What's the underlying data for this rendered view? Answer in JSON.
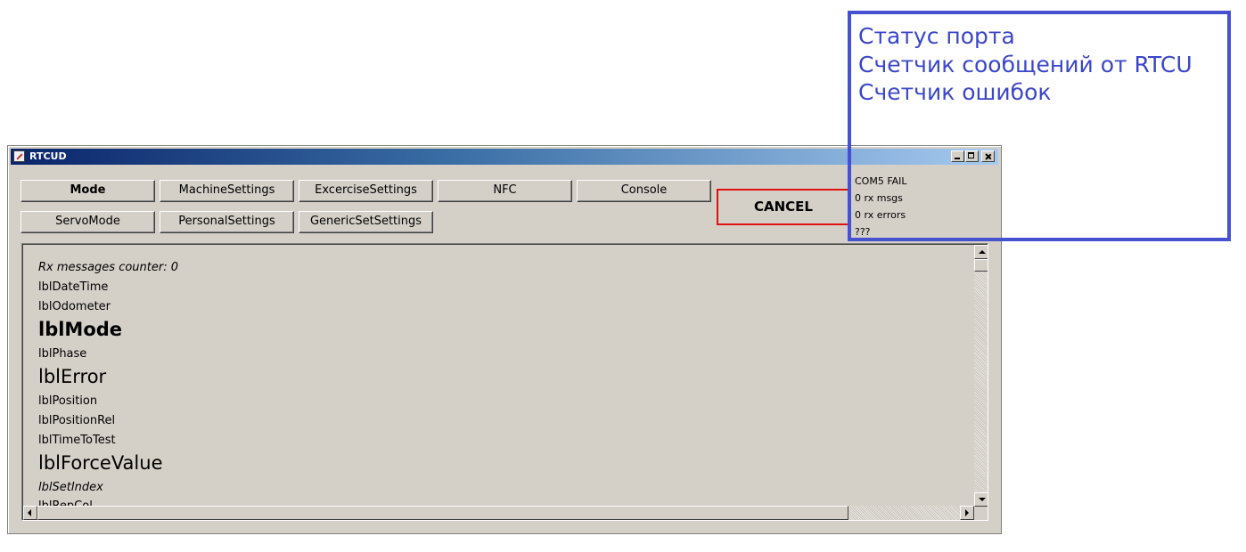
{
  "window": {
    "title": "RTCUD"
  },
  "toolbar": {
    "row1": [
      "Mode",
      "MachineSettings",
      "ExcerciseSettings",
      "NFC",
      "Console"
    ],
    "row2": [
      "ServoMode",
      "PersonalSettings",
      "GenericSetSettings"
    ],
    "cancel_label": "CANCEL"
  },
  "status": {
    "port": "COM5 FAIL",
    "rx_msgs": "0 rx msgs",
    "rx_errors": "0 rx errors",
    "extra": "???"
  },
  "content": {
    "rx_counter": "Rx messages counter: 0",
    "date_time": "lblDateTime",
    "odometer": "lblOdometer",
    "mode": "lblMode",
    "phase": "lblPhase",
    "error": "lblError",
    "position": "lblPosition",
    "position_rel": "lblPositionRel",
    "time_to_test": "lblTimeToTest",
    "force_value": "lblForceValue",
    "set_index": "lblSetIndex",
    "cut_off": "lblRepCol..."
  },
  "annotation": {
    "lines": [
      "Статус порта",
      "Счетчик сообщений от RTCU",
      "Счетчик ошибок"
    ],
    "color": "#4651d0"
  }
}
